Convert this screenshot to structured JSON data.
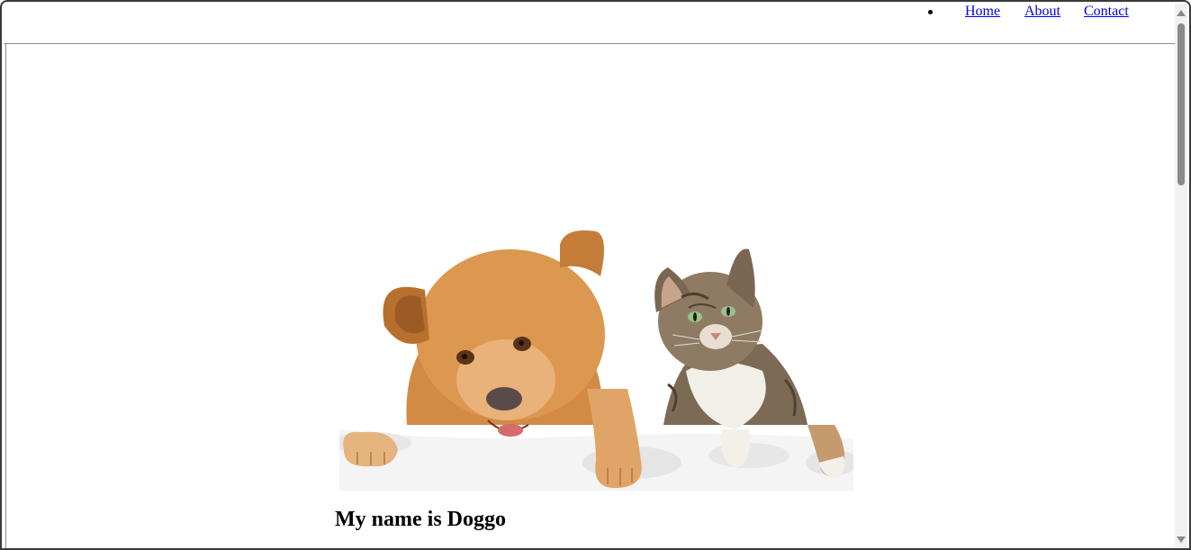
{
  "nav": {
    "items": [
      {
        "label": "Home"
      },
      {
        "label": "About"
      },
      {
        "label": "Contact"
      }
    ]
  },
  "main": {
    "hero_image": {
      "icon": "dog-and-cat-photo"
    },
    "title": "My name is Doggo"
  },
  "colors": {
    "link": "#0000ee",
    "scrollbar_thumb": "#8a8a8a",
    "dog_fur": "#d9924a",
    "cat_fur": "#8a7560"
  }
}
